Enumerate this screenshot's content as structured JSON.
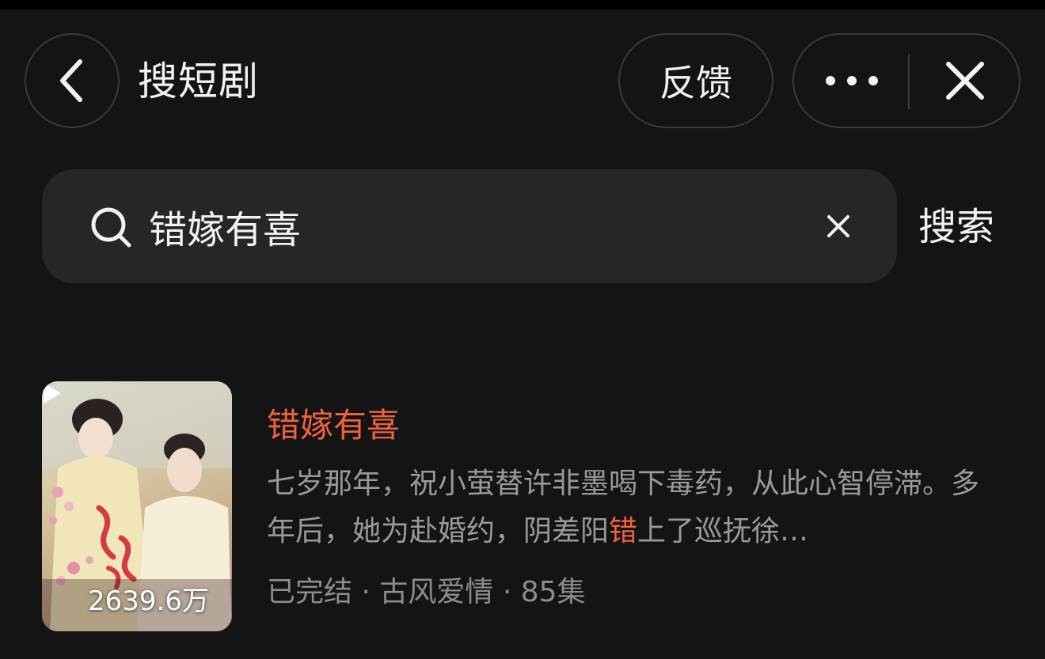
{
  "header": {
    "title": "搜短剧",
    "feedback_label": "反馈"
  },
  "search": {
    "query": "错嫁有喜",
    "submit_label": "搜索"
  },
  "result": {
    "title": "错嫁有喜",
    "description_before": "七岁那年，祝小萤替许非墨喝下毒药，从此心智停滞。多年后，她为赴婚约，阴差阳",
    "description_highlight": "错",
    "description_after": "上了巡抚徐…",
    "play_count": "2639.6万",
    "status": "已完结",
    "genre": "古风爱情",
    "episodes": "85集",
    "meta_separator": " · "
  },
  "colors": {
    "background": "#141414",
    "highlight": "#f0623e",
    "secondary_text": "#9a9a9a"
  },
  "icons": [
    "chevron-left-icon",
    "more-dots-icon",
    "close-icon",
    "search-icon",
    "clear-icon",
    "play-icon"
  ]
}
